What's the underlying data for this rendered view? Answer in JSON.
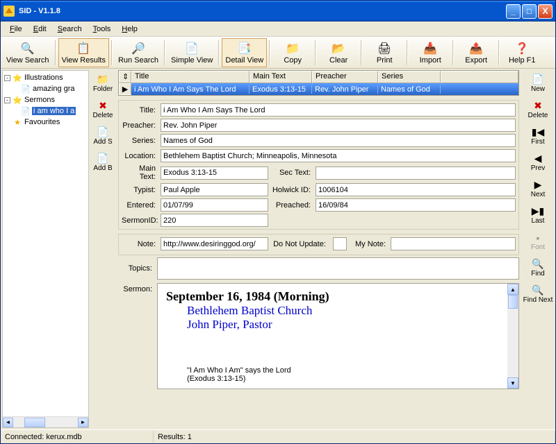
{
  "window": {
    "title": "SID - V1.1.8"
  },
  "menu": {
    "file": "File",
    "edit": "Edit",
    "search": "Search",
    "tools": "Tools",
    "help": "Help"
  },
  "toolbar": {
    "view_search": "View Search",
    "view_results": "View Results",
    "run_search": "Run Search",
    "simple_view": "Simple View",
    "detail_view": "Detail View",
    "copy": "Copy",
    "clear": "Clear",
    "print": "Print",
    "import": "Import",
    "export": "Export",
    "help": "Help F1"
  },
  "tree": {
    "illustrations": "Illustrations",
    "amazing": "amazing gra",
    "sermons": "Sermons",
    "sel": "i am who I a",
    "favourites": "Favourites"
  },
  "left_actions": {
    "folder": "Folder",
    "delete": "Delete",
    "add_s": "Add S",
    "add_b": "Add B"
  },
  "grid": {
    "hd_title": "Title",
    "hd_main": "Main Text",
    "hd_preacher": "Preacher",
    "hd_series": "Series",
    "title": "i Am Who I Am Says The Lord",
    "main": "Exodus 3:13-15",
    "preacher": "Rev. John Piper",
    "series": "Names of God"
  },
  "form": {
    "lbl_title": "Title:",
    "title": "i Am Who I Am Says The Lord",
    "lbl_preacher": "Preacher:",
    "preacher": "Rev. John Piper",
    "lbl_series": "Series:",
    "series": "Names of God",
    "lbl_location": "Location:",
    "location": "Bethlehem Baptist Church; Minneapolis, Minnesota",
    "lbl_maintext": "Main Text:",
    "maintext": "Exodus 3:13-15",
    "lbl_sectext": "Sec Text:",
    "sectext": "",
    "lbl_typist": "Typist:",
    "typist": "Paul Apple",
    "lbl_holwick": "Holwick ID:",
    "holwick": "1006104",
    "lbl_entered": "Entered:",
    "entered": "01/07/99",
    "lbl_preached": "Preached:",
    "preached": "16/09/84",
    "lbl_sermonid": "SermonID:",
    "sermonid": "220",
    "lbl_note": "Note:",
    "note": "http://www.desiringgod.org/",
    "lbl_donotupdate": "Do Not Update:",
    "lbl_mynote": "My Note:",
    "mynote": "",
    "lbl_topics": "Topics:",
    "topics": "",
    "lbl_sermon": "Sermon:"
  },
  "sermon": {
    "h1": "September 16, 1984 (Morning)",
    "h2a": "Bethlehem Baptist Church",
    "h2b": "John Piper, Pastor",
    "line1": "\"I Am Who I Am\" says the Lord",
    "line2": "(Exodus 3:13-15)"
  },
  "right": {
    "new": "New",
    "delete": "Delete",
    "first": "First",
    "prev": "Prev",
    "next": "Next",
    "last": "Last",
    "font": "Font",
    "find": "Find",
    "findnext": "Find Next"
  },
  "status": {
    "conn": "Connected: kerux.mdb",
    "results": "Results: 1"
  }
}
